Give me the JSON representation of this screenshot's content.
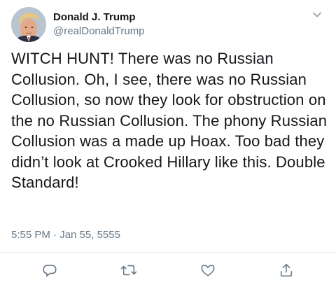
{
  "user": {
    "display_name": "Donald J. Trump",
    "handle": "@realDonaldTrump",
    "avatar_icon": "avatar-portrait"
  },
  "tweet": {
    "text": "WITCH HUNT! There was no Russian Collusion. Oh, I see, there was no Russian Collusion, so now they look for obstruction on the no Russian Collusion. The phony Russian Collusion was a made up Hoax. Too bad they didn’t look at Crooked Hillary like this. Double Standard!",
    "timestamp": "5:55 PM · Jan 55, 5555"
  },
  "actions": [
    {
      "name": "reply",
      "icon": "reply-icon"
    },
    {
      "name": "retweet",
      "icon": "retweet-icon"
    },
    {
      "name": "like",
      "icon": "heart-icon"
    },
    {
      "name": "share",
      "icon": "share-icon"
    }
  ],
  "colors": {
    "text_primary": "#14171a",
    "text_secondary": "#657786",
    "divider": "#e6ecf0",
    "icon": "#657786"
  }
}
